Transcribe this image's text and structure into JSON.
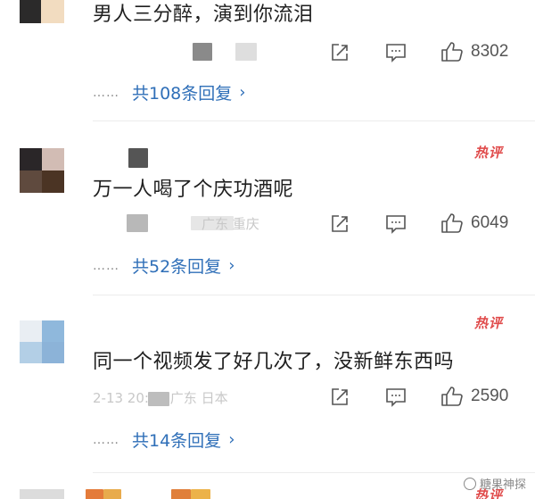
{
  "comments": [
    {
      "text": "男人三分醉，演到你流泪",
      "likes": "8302",
      "replies_label": "共108条回复",
      "hot": false
    },
    {
      "text": "万一人喝了个庆功酒呢",
      "meta_fragment": "广东 重庆",
      "likes": "6049",
      "replies_label": "共52条回复",
      "hot": true,
      "hot_label": "热评"
    },
    {
      "text": "同一个视频发了好几次了，没新鲜东西吗",
      "meta_fragment": "2-13 20:35 广东 日本",
      "likes": "2590",
      "replies_label": "共14条回复",
      "hot": true,
      "hot_label": "热评"
    },
    {
      "hot": true,
      "hot_label": "热评"
    }
  ],
  "replies_prefix": "……",
  "chevron": "›",
  "watermark": "糖果神探",
  "icons": [
    "share-icon",
    "comment-icon",
    "like-icon",
    "chevron-right-icon"
  ],
  "colors": {
    "link": "#2f6fb8",
    "hot": "#e04b4b",
    "text": "#1f1f1f",
    "meta": "#555555"
  }
}
